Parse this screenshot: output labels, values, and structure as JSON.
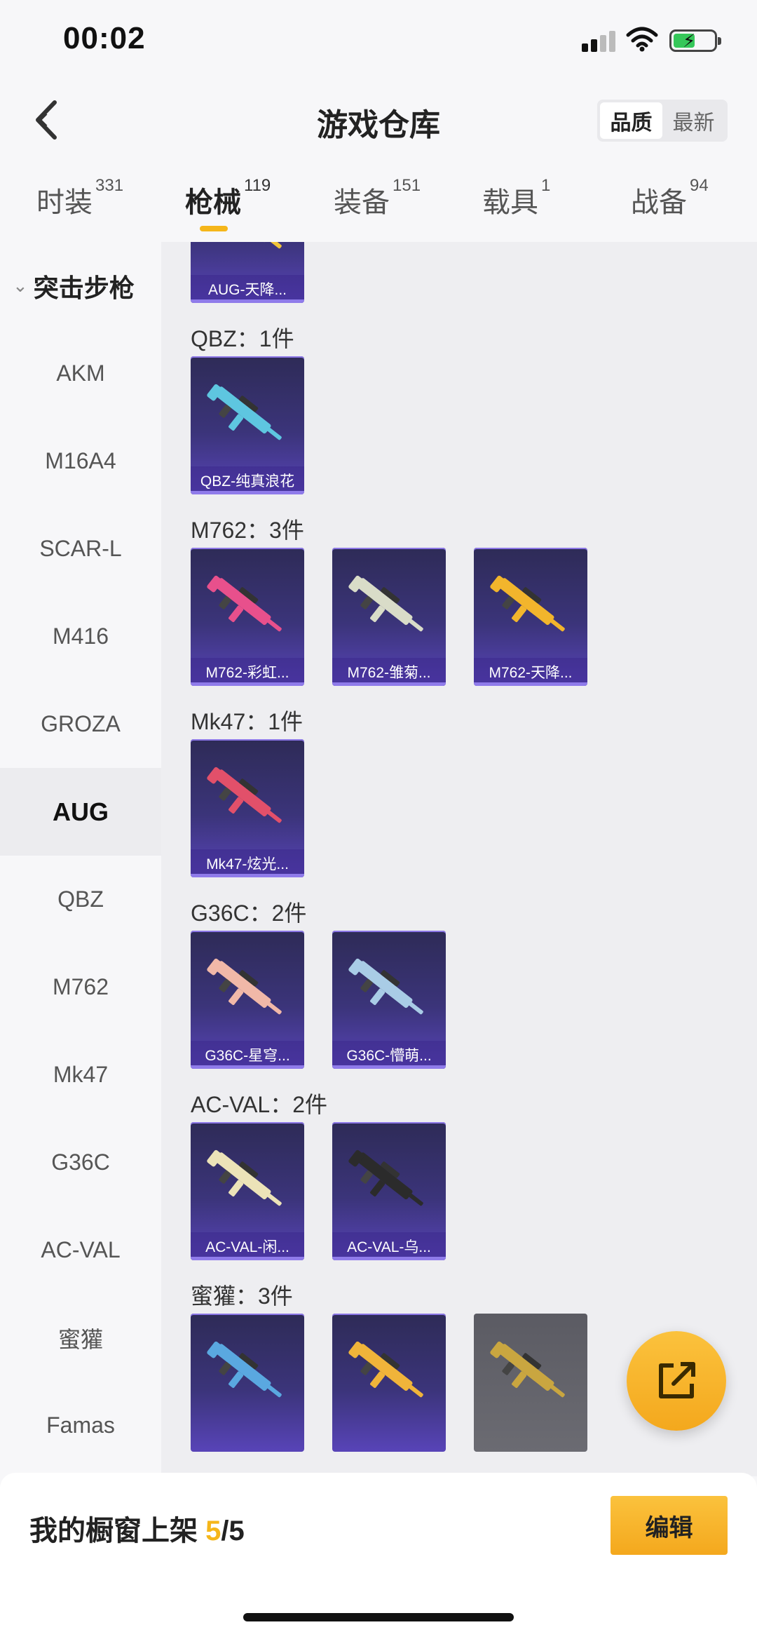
{
  "status_bar": {
    "time": "00:02"
  },
  "header": {
    "title": "游戏仓库",
    "sort_options": [
      "品质",
      "最新"
    ],
    "sort_selected": "品质"
  },
  "tabs": [
    {
      "label": "时装",
      "count": "331"
    },
    {
      "label": "枪械",
      "count": "119"
    },
    {
      "label": "装备",
      "count": "151"
    },
    {
      "label": "载具",
      "count": "1"
    },
    {
      "label": "战备",
      "count": "94"
    }
  ],
  "sidebar": {
    "group": "突击步枪",
    "items": [
      "AKM",
      "M16A4",
      "SCAR-L",
      "M416",
      "GROZA",
      "AUG",
      "QBZ",
      "M762",
      "Mk47",
      "G36C",
      "AC-VAL",
      "蜜獾",
      "Famas"
    ],
    "selected": "AUG"
  },
  "content": {
    "sections": [
      {
        "label": "",
        "items": [
          {
            "name": "AUG-天降...",
            "color": "#f0c43a"
          }
        ]
      },
      {
        "label": "QBZ：1件",
        "items": [
          {
            "name": "QBZ-纯真浪花",
            "color": "#5ec6e0"
          }
        ]
      },
      {
        "label": "M762：3件",
        "items": [
          {
            "name": "M762-彩虹...",
            "color": "#e8508c"
          },
          {
            "name": "M762-雏菊...",
            "color": "#d9dcc8"
          },
          {
            "name": "M762-天降...",
            "color": "#f2b52c"
          }
        ]
      },
      {
        "label": "Mk47：1件",
        "items": [
          {
            "name": "Mk47-炫光...",
            "color": "#e2506a"
          }
        ]
      },
      {
        "label": "G36C：2件",
        "items": [
          {
            "name": "G36C-星穹...",
            "color": "#f1b8a8"
          },
          {
            "name": "G36C-懵萌...",
            "color": "#a9cce6"
          }
        ]
      },
      {
        "label": "AC-VAL：2件",
        "items": [
          {
            "name": "AC-VAL-闲...",
            "color": "#ece3b8"
          },
          {
            "name": "AC-VAL-乌...",
            "color": "#2b2b2b"
          }
        ]
      },
      {
        "label": "蜜獾：3件",
        "items": [
          {
            "name": "",
            "color": "#5aa8e0"
          },
          {
            "name": "",
            "color": "#f0b43a"
          },
          {
            "name": "",
            "color": "#c9a640"
          }
        ]
      }
    ]
  },
  "bottom_bar": {
    "label": "我的橱窗上架",
    "count": "5",
    "total": "/5",
    "edit_button": "编辑"
  }
}
